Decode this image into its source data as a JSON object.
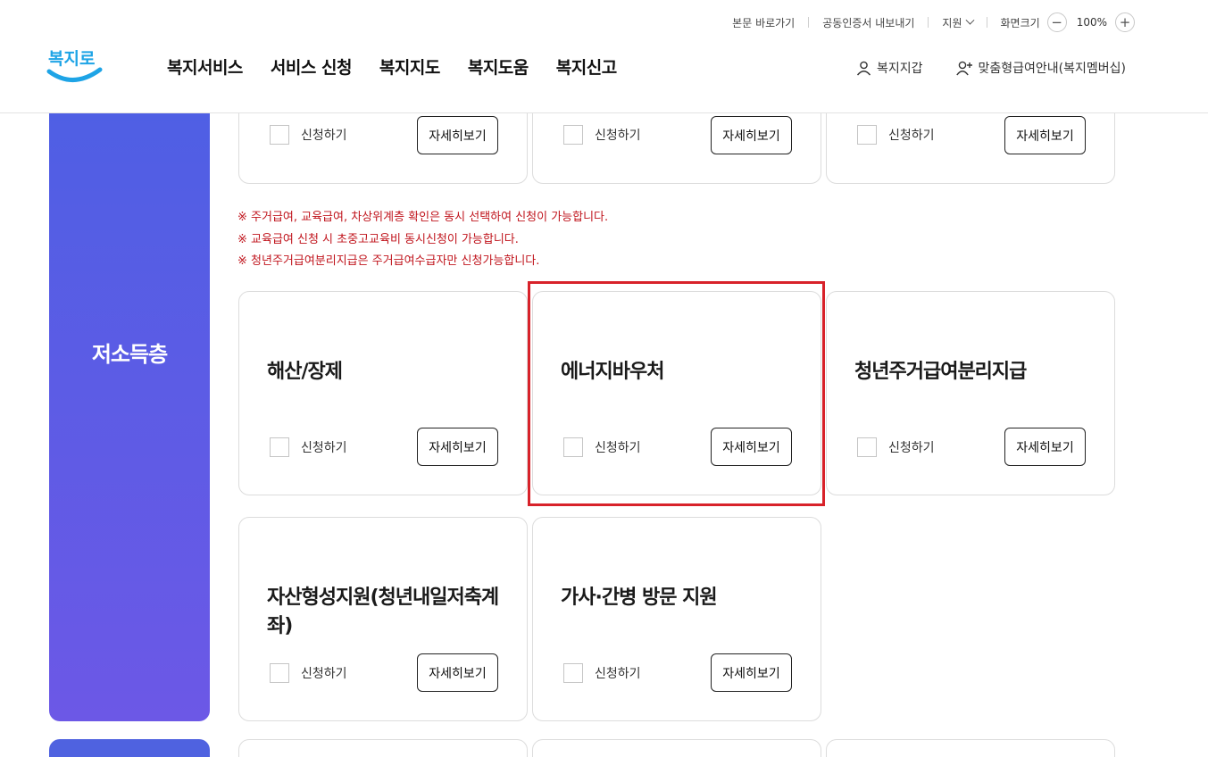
{
  "util_links": {
    "skip": "본문 바로가기",
    "cert": "공동인증서 내보내기",
    "support": "지원",
    "screen": "화면크기",
    "zoom_out": "−",
    "zoom_value": "100%",
    "zoom_in": "+"
  },
  "logo_text": "복지로",
  "gnb": [
    "복지서비스",
    "서비스 신청",
    "복지지도",
    "복지도움",
    "복지신고"
  ],
  "member": {
    "wallet": "복지지갑",
    "membership": "맞춤형급여안내(복지멤버십)"
  },
  "category": {
    "title": "저소득층"
  },
  "common": {
    "apply_label": "신청하기",
    "detail_label": "자세히보기"
  },
  "notices": [
    "※ 주거급여, 교육급여, 차상위계층 확인은 동시 선택하여 신청이 가능합니다.",
    "※ 교육급여 신청 시 초중고교육비 동시신청이 가능합니다.",
    "※ 청년주거급여분리지급은 주거급여수급자만 신청가능합니다."
  ],
  "cards": [
    {
      "title": "해산/장제"
    },
    {
      "title": "에너지바우처"
    },
    {
      "title": "청년주거급여분리지급"
    },
    {
      "title": "자산형성지원(청년내일저축계좌)"
    },
    {
      "title": "가사·간병 방문 지원"
    }
  ],
  "colors": {
    "category_gradient_top": "#4f5fe4",
    "category_gradient_bottom": "#6c58e6",
    "notice": "#c0141c",
    "highlight": "#d8222a",
    "logo_blue": "#1ea4e6"
  }
}
